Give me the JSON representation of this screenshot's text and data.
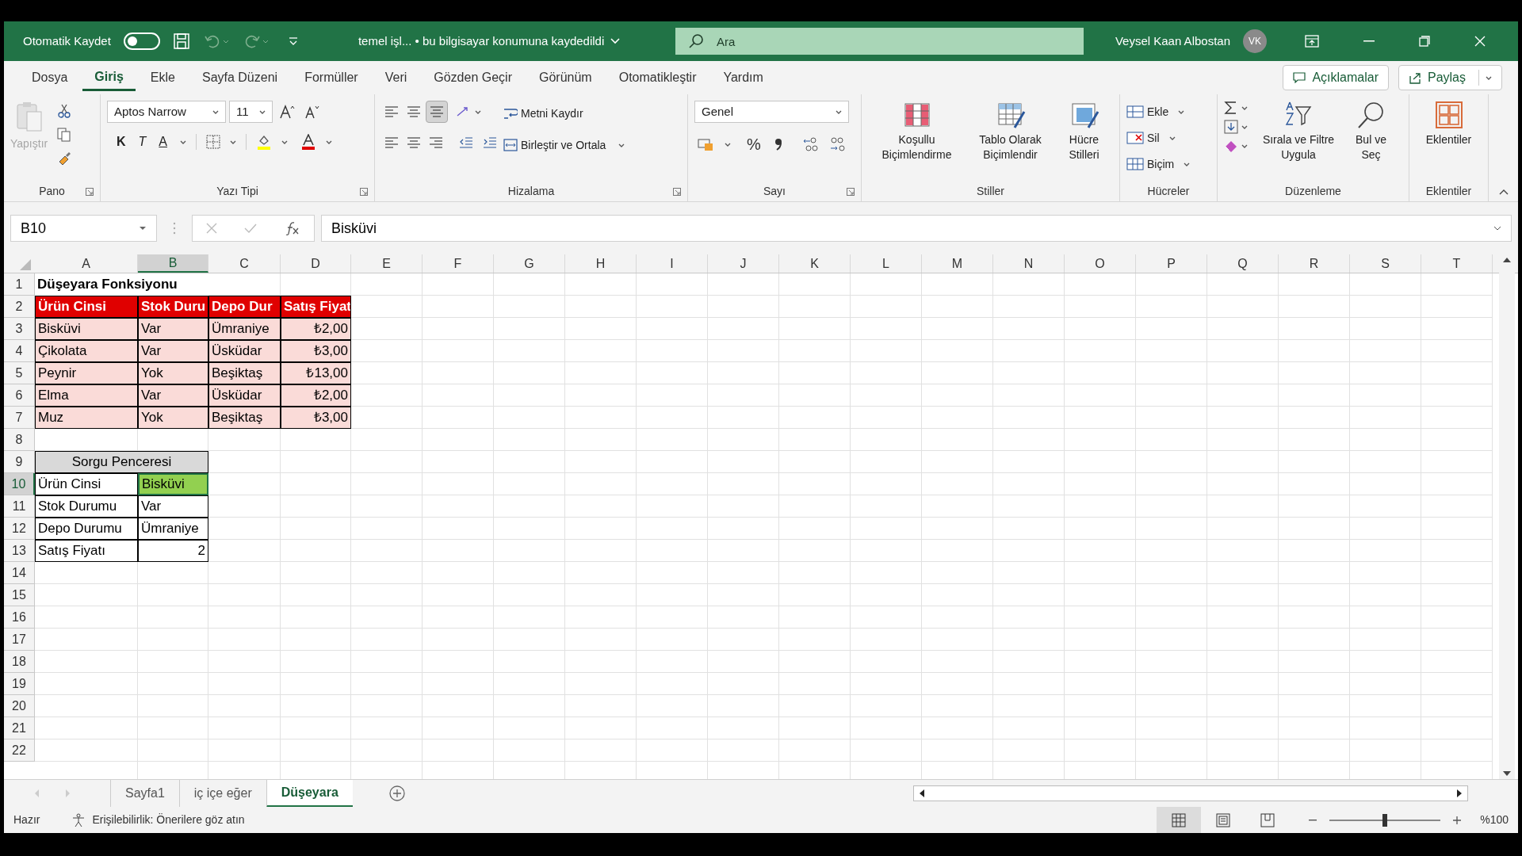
{
  "title_bar": {
    "autosave_label": "Otomatik Kaydet",
    "autosave_on": false,
    "document": "temel işl... • bu bilgisayar konumuna kaydedildi",
    "search_placeholder": "Ara",
    "user": "Veysel Kaan Albostan",
    "avatar": "VK"
  },
  "ribbon_tabs": [
    {
      "label": "Dosya",
      "selected": false
    },
    {
      "label": "Giriş",
      "selected": true
    },
    {
      "label": "Ekle",
      "selected": false
    },
    {
      "label": "Sayfa Düzeni",
      "selected": false
    },
    {
      "label": "Formüller",
      "selected": false
    },
    {
      "label": "Veri",
      "selected": false
    },
    {
      "label": "Gözden Geçir",
      "selected": false
    },
    {
      "label": "Görünüm",
      "selected": false
    },
    {
      "label": "Otomatikleştir",
      "selected": false
    },
    {
      "label": "Yardım",
      "selected": false
    }
  ],
  "ribbon_actions": [
    "Açıklamalar",
    "Paylaş"
  ],
  "ribbon_groups": [
    {
      "label": "Pano",
      "kind": "clipboard",
      "paste": "Yapıştır",
      "paste_disabled": true
    },
    {
      "label": "Yazı Tipi",
      "kind": "font",
      "font": "Aptos Narrow",
      "size": "11",
      "bold": "K",
      "italic": "T",
      "underline": "A"
    },
    {
      "label": "Hizalama",
      "kind": "alignment",
      "wrap": "Metni Kaydır",
      "merge": "Birleştir ve Ortala"
    },
    {
      "label": "Sayı",
      "kind": "number",
      "format": "Genel",
      "percent": "%"
    },
    {
      "label": "Stiller",
      "kind": "styles",
      "buttons": [
        "Koşullu Biçimlendirme",
        "Tablo Olarak Biçimlendir",
        "Hücre Stilleri"
      ]
    },
    {
      "label": "Hücreler",
      "kind": "cells",
      "buttons": [
        "Ekle",
        "Sil",
        "Biçim"
      ]
    },
    {
      "label": "Düzenleme",
      "kind": "editing",
      "buttons": [
        "Sırala ve Filtre Uygula",
        "Bul ve Seç"
      ]
    },
    {
      "label": "Eklentiler",
      "kind": "addins",
      "buttons": [
        "Eklentiler"
      ]
    }
  ],
  "formula_bar": {
    "name_box": "B10",
    "formula": "Bisküvi"
  },
  "sheet": {
    "columns": [
      {
        "label": "A",
        "selected": false
      },
      {
        "label": "B",
        "selected": true
      },
      {
        "label": "C",
        "selected": false
      },
      {
        "label": "D",
        "selected": false
      },
      {
        "label": "E",
        "selected": false
      },
      {
        "label": "F",
        "selected": false
      },
      {
        "label": "G",
        "selected": false
      },
      {
        "label": "H",
        "selected": false
      },
      {
        "label": "I",
        "selected": false
      },
      {
        "label": "J",
        "selected": false
      },
      {
        "label": "K",
        "selected": false
      },
      {
        "label": "L",
        "selected": false
      },
      {
        "label": "M",
        "selected": false
      },
      {
        "label": "N",
        "selected": false
      },
      {
        "label": "O",
        "selected": false
      },
      {
        "label": "P",
        "selected": false
      },
      {
        "label": "Q",
        "selected": false
      },
      {
        "label": "R",
        "selected": false
      },
      {
        "label": "S",
        "selected": false
      },
      {
        "label": "T",
        "selected": false
      }
    ],
    "rows": [
      {
        "number": "1",
        "selected": false,
        "cells": [
          {
            "text": "Düşeyara Fonksiyonu",
            "kind": "title"
          }
        ]
      },
      {
        "number": "2",
        "selected": false,
        "cells": [
          {
            "text": "Ürün Cinsi",
            "kind": "header"
          },
          {
            "text": "Stok Duru",
            "kind": "header"
          },
          {
            "text": "Depo Dur",
            "kind": "header"
          },
          {
            "text": "Satış Fiyat",
            "kind": "header"
          }
        ]
      },
      {
        "number": "3",
        "selected": false,
        "cells": [
          {
            "text": "Bisküvi",
            "kind": "data"
          },
          {
            "text": "Var",
            "kind": "data"
          },
          {
            "text": "Ümraniye",
            "kind": "data"
          },
          {
            "text": "₺2,00",
            "kind": "price"
          }
        ]
      },
      {
        "number": "4",
        "selected": false,
        "cells": [
          {
            "text": "Çikolata",
            "kind": "data"
          },
          {
            "text": "Var",
            "kind": "data"
          },
          {
            "text": "Üsküdar",
            "kind": "data"
          },
          {
            "text": "₺3,00",
            "kind": "price"
          }
        ]
      },
      {
        "number": "5",
        "selected": false,
        "cells": [
          {
            "text": "Peynir",
            "kind": "data"
          },
          {
            "text": "Yok",
            "kind": "data"
          },
          {
            "text": "Beşiktaş",
            "kind": "data"
          },
          {
            "text": "₺13,00",
            "kind": "price"
          }
        ]
      },
      {
        "number": "6",
        "selected": false,
        "cells": [
          {
            "text": "Elma",
            "kind": "data"
          },
          {
            "text": "Var",
            "kind": "data"
          },
          {
            "text": "Üsküdar",
            "kind": "data"
          },
          {
            "text": "₺2,00",
            "kind": "price"
          }
        ]
      },
      {
        "number": "7",
        "selected": false,
        "cells": [
          {
            "text": "Muz",
            "kind": "data"
          },
          {
            "text": "Yok",
            "kind": "data"
          },
          {
            "text": "Beşiktaş",
            "kind": "data"
          },
          {
            "text": "₺3,00",
            "kind": "price"
          }
        ]
      },
      {
        "number": "8",
        "selected": false,
        "cells": []
      },
      {
        "number": "9",
        "selected": false,
        "cells": [
          {
            "text": "Sorgu Penceresi",
            "kind": "query-title"
          }
        ]
      },
      {
        "number": "10",
        "selected": true,
        "cells": [
          {
            "text": "Ürün Cinsi",
            "kind": "label"
          },
          {
            "text": "Bisküvi",
            "kind": "active"
          }
        ]
      },
      {
        "number": "11",
        "selected": false,
        "cells": [
          {
            "text": "Stok Durumu",
            "kind": "label"
          },
          {
            "text": "Var",
            "kind": "label"
          }
        ]
      },
      {
        "number": "12",
        "selected": false,
        "cells": [
          {
            "text": "Depo Durumu",
            "kind": "label"
          },
          {
            "text": "Ümraniye",
            "kind": "label"
          }
        ]
      },
      {
        "number": "13",
        "selected": false,
        "cells": [
          {
            "text": "Satış Fiyatı",
            "kind": "label"
          },
          {
            "text": "2",
            "kind": "number"
          }
        ]
      },
      {
        "number": "14",
        "selected": false,
        "cells": []
      },
      {
        "number": "15",
        "selected": false,
        "cells": []
      },
      {
        "number": "16",
        "selected": false,
        "cells": []
      },
      {
        "number": "17",
        "selected": false,
        "cells": []
      },
      {
        "number": "18",
        "selected": false,
        "cells": []
      },
      {
        "number": "19",
        "selected": false,
        "cells": []
      },
      {
        "number": "20",
        "selected": false,
        "cells": []
      },
      {
        "number": "21",
        "selected": false,
        "cells": []
      },
      {
        "number": "22",
        "selected": false,
        "cells": []
      }
    ]
  },
  "sheet_tabs": [
    {
      "label": "Sayfa1",
      "selected": false
    },
    {
      "label": "iç içe eğer",
      "selected": false
    },
    {
      "label": "Düşeyara",
      "selected": true
    }
  ],
  "status_bar": {
    "ready": "Hazır",
    "accessibility": "Erişilebilirlik: Önerilere göz atın",
    "views": [
      {
        "kind": "normal",
        "selected": true
      },
      {
        "kind": "page-layout",
        "selected": false
      },
      {
        "kind": "page-break",
        "selected": false
      }
    ],
    "level": 0.5,
    "zoom": "%100"
  }
}
